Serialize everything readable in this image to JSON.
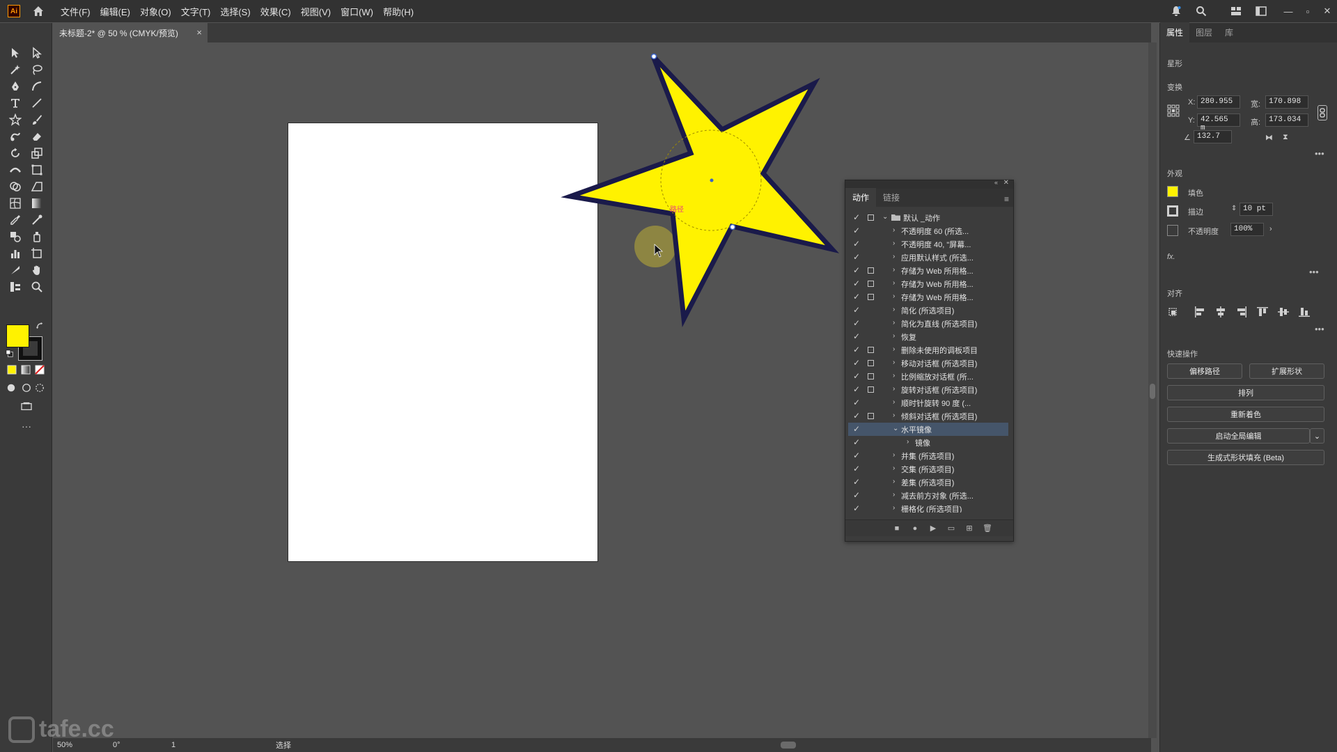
{
  "app": {
    "logo_text": "Ai",
    "menus": [
      "文件(F)",
      "编辑(E)",
      "对象(O)",
      "文字(T)",
      "选择(S)",
      "效果(C)",
      "视图(V)",
      "窗口(W)",
      "帮助(H)"
    ]
  },
  "document_tab": {
    "title": "未标题-2* @ 50 % (CMYK/预览)",
    "close_glyph": "×"
  },
  "canvas": {
    "star_fill": "#fff200",
    "star_stroke": "#1a1a4a",
    "selection_label": "路径"
  },
  "status": {
    "zoom": "50%",
    "rotation": "0°",
    "page": "1",
    "tool": "选择"
  },
  "watermark": "tafe.cc",
  "actions_panel": {
    "tabs": [
      "动作",
      "链接"
    ],
    "rows": [
      {
        "label": "默认 _动作",
        "box": true,
        "arrow": "⌄",
        "level": 0,
        "folder": true
      },
      {
        "label": "不透明度 60 (所选...",
        "box": false,
        "arrow": "›",
        "level": 1
      },
      {
        "label": "不透明度 40, \"屏幕...",
        "box": false,
        "arrow": "›",
        "level": 1
      },
      {
        "label": "应用默认样式 (所选...",
        "box": false,
        "arrow": "›",
        "level": 1
      },
      {
        "label": "存储为 Web 所用格...",
        "box": true,
        "arrow": "›",
        "level": 1
      },
      {
        "label": "存储为 Web 所用格...",
        "box": true,
        "arrow": "›",
        "level": 1
      },
      {
        "label": "存储为 Web 所用格...",
        "box": true,
        "arrow": "›",
        "level": 1
      },
      {
        "label": "简化 (所选项目)",
        "box": false,
        "arrow": "›",
        "level": 1
      },
      {
        "label": "简化为直线 (所选项目)",
        "box": false,
        "arrow": "›",
        "level": 1
      },
      {
        "label": "恢复",
        "box": false,
        "arrow": "›",
        "level": 1
      },
      {
        "label": "删除未使用的调板项目",
        "box": true,
        "arrow": "›",
        "level": 1
      },
      {
        "label": "移动对话框 (所选项目)",
        "box": true,
        "arrow": "›",
        "level": 1
      },
      {
        "label": "比例缩放对话框 (所...",
        "box": true,
        "arrow": "›",
        "level": 1
      },
      {
        "label": "旋转对话框 (所选项目)",
        "box": true,
        "arrow": "›",
        "level": 1
      },
      {
        "label": "顺时针旋转 90 度 (...",
        "box": false,
        "arrow": "›",
        "level": 1
      },
      {
        "label": "倾斜对话框 (所选项目)",
        "box": true,
        "arrow": "›",
        "level": 1
      },
      {
        "label": "水平镜像",
        "box": false,
        "arrow": "⌄",
        "level": 1,
        "selected": true
      },
      {
        "label": "镜像",
        "box": false,
        "arrow": "›",
        "level": 2
      },
      {
        "label": "并集 (所选项目)",
        "box": false,
        "arrow": "›",
        "level": 1
      },
      {
        "label": "交集 (所选项目)",
        "box": false,
        "arrow": "›",
        "level": 1
      },
      {
        "label": "差集 (所选项目)",
        "box": false,
        "arrow": "›",
        "level": 1
      },
      {
        "label": "减去前方对象 (所选...",
        "box": false,
        "arrow": "›",
        "level": 1
      },
      {
        "label": "栅格化 (所选项目)",
        "box": false,
        "arrow": "›",
        "level": 1
      }
    ],
    "check_glyph": "✓",
    "bottom_buttons": [
      "■",
      "●",
      "▶",
      "▭",
      "⊞",
      "🗑"
    ]
  },
  "properties": {
    "tabs": [
      "属性",
      "图层",
      "库"
    ],
    "object_type": "星形",
    "transform": {
      "title": "变换",
      "x_label": "X:",
      "x": "280.955",
      "y_label": "Y:",
      "y": "42.565 m",
      "w_label": "宽:",
      "w": "170.898",
      "h_label": "高:",
      "h": "173.034",
      "angle": "132.7"
    },
    "appearance": {
      "title": "外观",
      "fill_label": "填色",
      "fill_color": "#fff200",
      "stroke_label": "描边",
      "stroke_value": "10 pt",
      "opacity_label": "不透明度",
      "opacity_value": "100%",
      "fx": "fx."
    },
    "align_title": "对齐",
    "quick": {
      "title": "快速操作",
      "offset_path": "偏移路径",
      "expand_shape": "扩展形状",
      "arrange": "排列",
      "recolor": "重新着色",
      "global_edit": "启动全局编辑",
      "generative_fill": "生成式形状填充 (Beta)"
    },
    "more_glyph": "•••"
  }
}
